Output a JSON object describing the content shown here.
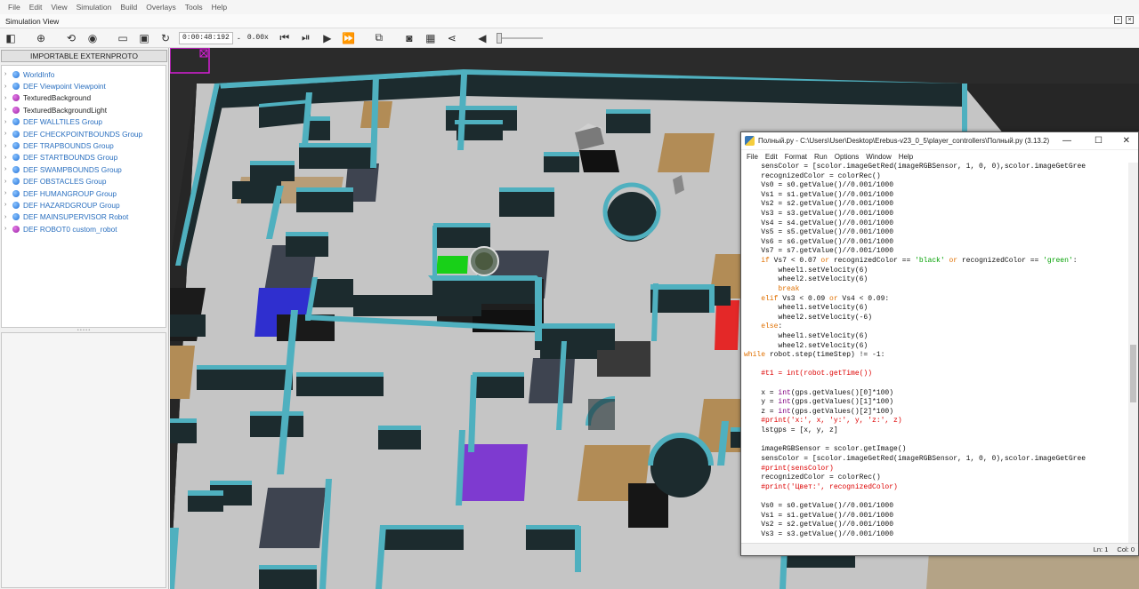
{
  "menu": [
    "File",
    "Edit",
    "View",
    "Simulation",
    "Build",
    "Overlays",
    "Tools",
    "Help"
  ],
  "view_title": "Simulation View",
  "toolbar": {
    "time": "0:00:48:192",
    "speed_sep": "-",
    "speed": "0.00x"
  },
  "sidebar": {
    "proto_button": "IMPORTABLE EXTERNPROTO",
    "nodes": [
      {
        "label": "WorldInfo",
        "icon": "blue"
      },
      {
        "label": "DEF Viewpoint Viewpoint",
        "icon": "blue"
      },
      {
        "label": "TexturedBackground",
        "icon": "purple"
      },
      {
        "label": "TexturedBackgroundLight",
        "icon": "purple"
      },
      {
        "label": "DEF WALLTILES Group",
        "icon": "blue"
      },
      {
        "label": "DEF CHECKPOINTBOUNDS Group",
        "icon": "blue"
      },
      {
        "label": "DEF TRAPBOUNDS Group",
        "icon": "blue"
      },
      {
        "label": "DEF STARTBOUNDS Group",
        "icon": "blue"
      },
      {
        "label": "DEF SWAMPBOUNDS Group",
        "icon": "blue"
      },
      {
        "label": "DEF OBSTACLES Group",
        "icon": "blue"
      },
      {
        "label": "DEF HUMANGROUP Group",
        "icon": "blue"
      },
      {
        "label": "DEF HAZARDGROUP Group",
        "icon": "blue"
      },
      {
        "label": "DEF MAINSUPERVISOR Robot",
        "icon": "blue"
      },
      {
        "label": "DEF ROBOT0 custom_robot",
        "icon": "purple"
      }
    ]
  },
  "editor": {
    "title": "Полный.py - C:\\Users\\User\\Desktop\\Erebus-v23_0_5\\player_controllers\\Полный.py (3.13.2)",
    "menu": [
      "File",
      "Edit",
      "Format",
      "Run",
      "Options",
      "Window",
      "Help"
    ],
    "status_line": "Ln: 1",
    "status_col": "Col: 0",
    "code": [
      [
        {
          "t": "    sensColor = [scolor.imageGetRed(imageRGBSensor, 1, 0, 0),scolor.imageGetGree"
        }
      ],
      [
        {
          "t": "    recognizedColor = colorRec()"
        }
      ],
      [
        {
          "t": "    Vs0 = s0.getValue()//0.001/1000"
        }
      ],
      [
        {
          "t": "    Vs1 = s1.getValue()//0.001/1000"
        }
      ],
      [
        {
          "t": "    Vs2 = s2.getValue()//0.001/1000"
        }
      ],
      [
        {
          "t": "    Vs3 = s3.getValue()//0.001/1000"
        }
      ],
      [
        {
          "t": "    Vs4 = s4.getValue()//0.001/1000"
        }
      ],
      [
        {
          "t": "    Vs5 = s5.getValue()//0.001/1000"
        }
      ],
      [
        {
          "t": "    Vs6 = s6.getValue()//0.001/1000"
        }
      ],
      [
        {
          "t": "    Vs7 = s7.getValue()//0.001/1000"
        }
      ],
      [
        {
          "t": "    "
        },
        {
          "t": "if",
          "c": "k"
        },
        {
          "t": " Vs7 < 0.07 "
        },
        {
          "t": "or",
          "c": "k"
        },
        {
          "t": " recognizedColor == "
        },
        {
          "t": "'black'",
          "c": "s"
        },
        {
          "t": " "
        },
        {
          "t": "or",
          "c": "k"
        },
        {
          "t": " recognizedColor == "
        },
        {
          "t": "'green'",
          "c": "s"
        },
        {
          "t": ":"
        }
      ],
      [
        {
          "t": "        wheel1.setVelocity(6)"
        }
      ],
      [
        {
          "t": "        wheel2.setVelocity(6)"
        }
      ],
      [
        {
          "t": "        "
        },
        {
          "t": "break",
          "c": "k"
        }
      ],
      [
        {
          "t": "    "
        },
        {
          "t": "elif",
          "c": "k"
        },
        {
          "t": " Vs3 < 0.09 "
        },
        {
          "t": "or",
          "c": "k"
        },
        {
          "t": " Vs4 < 0.09:"
        }
      ],
      [
        {
          "t": "        wheel1.setVelocity(6)"
        }
      ],
      [
        {
          "t": "        wheel2.setVelocity(-6)"
        }
      ],
      [
        {
          "t": "    "
        },
        {
          "t": "else",
          "c": "k"
        },
        {
          "t": ":"
        }
      ],
      [
        {
          "t": "        wheel1.setVelocity(6)"
        }
      ],
      [
        {
          "t": "        wheel2.setVelocity(6)"
        }
      ],
      [
        {
          "t": "while",
          "c": "k"
        },
        {
          "t": " robot.step(timeStep) != -1:"
        }
      ],
      [
        {
          "t": ""
        }
      ],
      [
        {
          "t": "    "
        },
        {
          "t": "#t1 = int(robot.getTime())",
          "c": "c"
        }
      ],
      [
        {
          "t": ""
        }
      ],
      [
        {
          "t": "    x = "
        },
        {
          "t": "int",
          "c": "b"
        },
        {
          "t": "(gps.getValues()[0]*100)"
        }
      ],
      [
        {
          "t": "    y = "
        },
        {
          "t": "int",
          "c": "b"
        },
        {
          "t": "(gps.getValues()[1]*100)"
        }
      ],
      [
        {
          "t": "    z = "
        },
        {
          "t": "int",
          "c": "b"
        },
        {
          "t": "(gps.getValues()[2]*100)"
        }
      ],
      [
        {
          "t": "    "
        },
        {
          "t": "#print('x:', x, 'y:', y, 'z:', z)",
          "c": "c"
        }
      ],
      [
        {
          "t": "    lstgps = [x, y, z]"
        }
      ],
      [
        {
          "t": ""
        }
      ],
      [
        {
          "t": "    imageRGBSensor = scolor.getImage()"
        }
      ],
      [
        {
          "t": "    sensColor = [scolor.imageGetRed(imageRGBSensor, 1, 0, 0),scolor.imageGetGree"
        }
      ],
      [
        {
          "t": "    "
        },
        {
          "t": "#print(sensColor)",
          "c": "c"
        }
      ],
      [
        {
          "t": "    recognizedColor = colorRec()"
        }
      ],
      [
        {
          "t": "    "
        },
        {
          "t": "#print('Цвет:', recognizedColor)",
          "c": "c"
        }
      ],
      [
        {
          "t": ""
        }
      ],
      [
        {
          "t": "    Vs0 = s0.getValue()//0.001/1000"
        }
      ],
      [
        {
          "t": "    Vs1 = s1.getValue()//0.001/1000"
        }
      ],
      [
        {
          "t": "    Vs2 = s2.getValue()//0.001/1000"
        }
      ],
      [
        {
          "t": "    Vs3 = s3.getValue()//0.001/1000"
        }
      ]
    ]
  },
  "colors": {
    "wall_top": "#4fb0bf",
    "floor": "#c4c4c4",
    "wall_side": "#1c2b2e",
    "checkpoint": "#b28c56",
    "swamp": "#404650"
  }
}
